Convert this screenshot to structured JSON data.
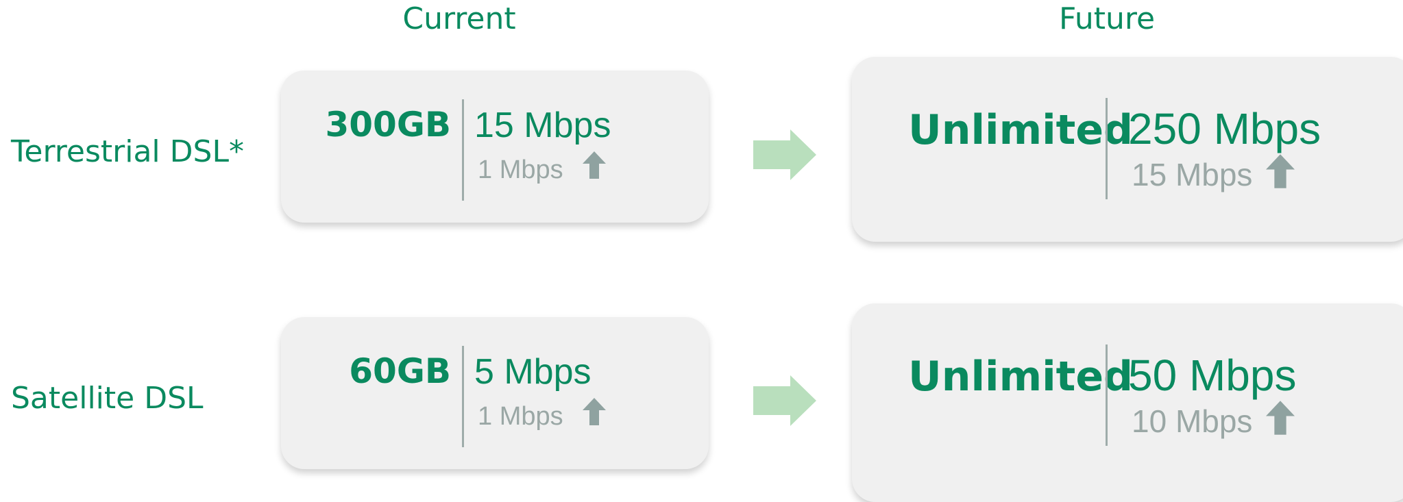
{
  "columns": {
    "current": "Current",
    "future": "Future"
  },
  "rows": [
    {
      "label": "Terrestrial DSL*",
      "current": {
        "data": "300GB",
        "download": "15 Mbps",
        "upload": "1 Mbps"
      },
      "future": {
        "data": "Unlimited",
        "download": "250 Mbps",
        "upload": "15 Mbps"
      }
    },
    {
      "label": "Satellite DSL",
      "current": {
        "data": "60GB",
        "download": "5 Mbps",
        "upload": "1 Mbps"
      },
      "future": {
        "data": "Unlimited",
        "download": "50 Mbps",
        "upload": "10 Mbps"
      }
    }
  ],
  "colors": {
    "brand_green": "#0a8a5f",
    "arrow_green": "#b9dfbd",
    "muted": "#9aa7a5",
    "card_bg": "#f0f0f0"
  },
  "icons": {
    "upload": "up-arrow-icon",
    "transition": "right-arrow-icon"
  }
}
